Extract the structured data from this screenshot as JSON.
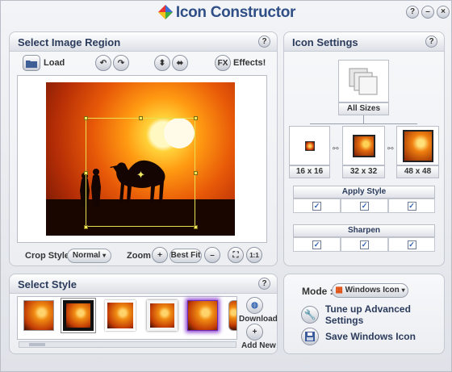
{
  "app": {
    "title": "Icon Constructor",
    "accent_color": "#2f4f86",
    "window_buttons": [
      "?",
      "–",
      "×"
    ]
  },
  "select_region": {
    "title": "Select Image Region",
    "help_label": "?",
    "load_label": "Load",
    "effects_label": "Effects!",
    "fx_label": "FX",
    "crop_style_label": "Crop Style :",
    "crop_style_value": "Normal",
    "zoom_label": "Zoom :",
    "zoom_in_label": "+",
    "zoom_best_fit_label": "Best Fit",
    "zoom_out_label": "–",
    "zoom_actual_label": "1:1"
  },
  "icon_settings": {
    "title": "Icon Settings",
    "help_label": "?",
    "all_sizes_label": "All Sizes",
    "sizes": [
      "16 x 16",
      "32 x 32",
      "48 x 48"
    ],
    "apply_style_label": "Apply Style",
    "apply_style_checks": [
      true,
      true,
      true
    ],
    "sharpen_label": "Sharpen",
    "sharpen_checks": [
      true,
      true,
      true
    ]
  },
  "select_style": {
    "title": "Select Style",
    "help_label": "?",
    "thumbs": [
      "plain",
      "black-frame",
      "white-frame",
      "white-border",
      "purple-glow",
      "rounded"
    ],
    "download_label": "Download",
    "add_new_label": "Add New"
  },
  "save_panel": {
    "mode_label": "Mode :",
    "mode_value": "Windows Icon",
    "tune_label": "Tune up Advanced Settings",
    "save_label": "Save Windows Icon"
  }
}
